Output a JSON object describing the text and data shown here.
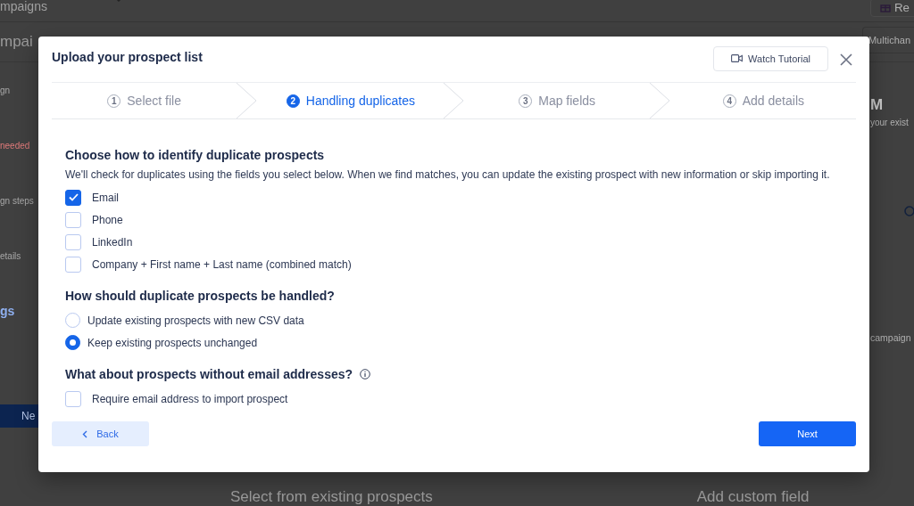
{
  "background": {
    "top_bar": {
      "title": "mpaigns",
      "button": "Re"
    },
    "page_title": "mpai",
    "tab": "Multichan",
    "sidebar_items": [
      {
        "label": "gn",
        "kind": "plain"
      },
      {
        "label": "needed",
        "kind": "alert"
      },
      {
        "label": "gn steps",
        "kind": "plain"
      },
      {
        "label": "etails",
        "kind": "plain"
      },
      {
        "label": "gs",
        "kind": "active"
      }
    ],
    "sidebar_button": "Ne",
    "right_panel": {
      "heading": "M",
      "text": "your exist",
      "footer": "campaign"
    },
    "bottom_cards": [
      "Select from existing prospects",
      "Add custom field"
    ]
  },
  "modal": {
    "title": "Upload your prospect list",
    "watch_tutorial": "Watch Tutorial",
    "steps": [
      {
        "number": "1",
        "label": "Select file",
        "selected": false
      },
      {
        "number": "2",
        "label": "Handling duplicates",
        "selected": true
      },
      {
        "number": "3",
        "label": "Map fields",
        "selected": false
      },
      {
        "number": "4",
        "label": "Add details",
        "selected": false
      }
    ],
    "sections": [
      {
        "kind": "checkbox",
        "heading": "Choose how to identify duplicate prospects",
        "description": "We'll check for duplicates using the fields you select below. When we find matches, you can update the existing prospect with new information or skip importing it.",
        "options": [
          {
            "label": "Email",
            "checked": true
          },
          {
            "label": "Phone",
            "checked": false
          },
          {
            "label": "LinkedIn",
            "checked": false
          },
          {
            "label": "Company + First name + Last name (combined match)",
            "checked": false
          }
        ]
      },
      {
        "kind": "radio",
        "heading": "How should duplicate prospects be handled?",
        "options": [
          {
            "label": "Update existing prospects with new CSV data",
            "selected": false
          },
          {
            "label": "Keep existing prospects unchanged",
            "selected": true
          }
        ]
      },
      {
        "kind": "checkbox",
        "heading": "What about prospects without email addresses?",
        "info": true,
        "options": [
          {
            "label": "Require email address to import prospect",
            "checked": false
          }
        ]
      }
    ],
    "back_button": "Back",
    "next_button": "Next"
  }
}
